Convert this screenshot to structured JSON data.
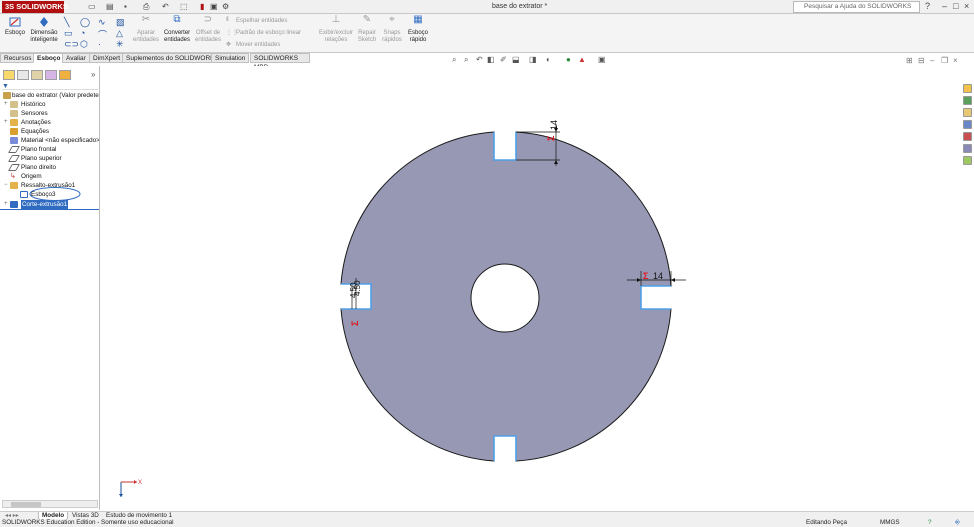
{
  "titlebar": {
    "app_name": "SOLIDWORKS",
    "document_title": "base do extrator *",
    "help_search_placeholder": "Pesquisar a Ajuda do SOLIDWORKS"
  },
  "commandmanager": {
    "sketch": "Esboço",
    "smart_dimension": "Dimensão inteligente",
    "trim": "Aparar entidades",
    "convert": "Converter entidades",
    "offset": "Offset de entidades",
    "mirror": "Espelhar entidades",
    "linear_pattern": "Padrão de esboço linear",
    "move": "Mover entidades",
    "display_relations": "Exibir/excluir relações",
    "repair": "Repair Sketch",
    "snaps": "Snaps rápidos",
    "rapid_sketch": "Esboço rápido"
  },
  "tabs": [
    "Recursos",
    "Esboço",
    "Avaliar",
    "DimXpert",
    "Suplementos do SOLIDWORKS",
    "Simulation",
    "SOLIDWORKS MBD"
  ],
  "tree": {
    "part": "base do extrator  (Valor predeter",
    "items": [
      {
        "label": "Histórico"
      },
      {
        "label": "Sensores"
      },
      {
        "label": "Anotações"
      },
      {
        "label": "Equações"
      },
      {
        "label": "Material <não especificado>"
      },
      {
        "label": "Plano frontal"
      },
      {
        "label": "Plano superior"
      },
      {
        "label": "Plano direito"
      },
      {
        "label": "Origem"
      },
      {
        "label": "Ressalto-extrusão1"
      },
      {
        "label": "Esboço3"
      },
      {
        "label": "Corte-extrusão1"
      }
    ]
  },
  "dimensions": {
    "top_slot": "14",
    "right_slot": "14",
    "left_slot_a": "4.50",
    "left_slot_b": "4.50"
  },
  "bottom_tabs": [
    "Modelo",
    "Vistas 3D",
    "Estudo de movimento 1"
  ],
  "status": {
    "edition": "SOLIDWORKS Education Edition - Somente uso educacional",
    "mode": "Editando Peça",
    "units": "MMGS"
  },
  "colors": {
    "part_fill": "#9799b4",
    "selection": "#2f6cc1",
    "dimension_red": "#e0141e",
    "slot_edge": "#4fa0e8"
  },
  "icons": {
    "sketch": "sketch-icon",
    "smart_dimension": "smart-dimension-icon",
    "triad": "coordinate-triad-icon"
  }
}
